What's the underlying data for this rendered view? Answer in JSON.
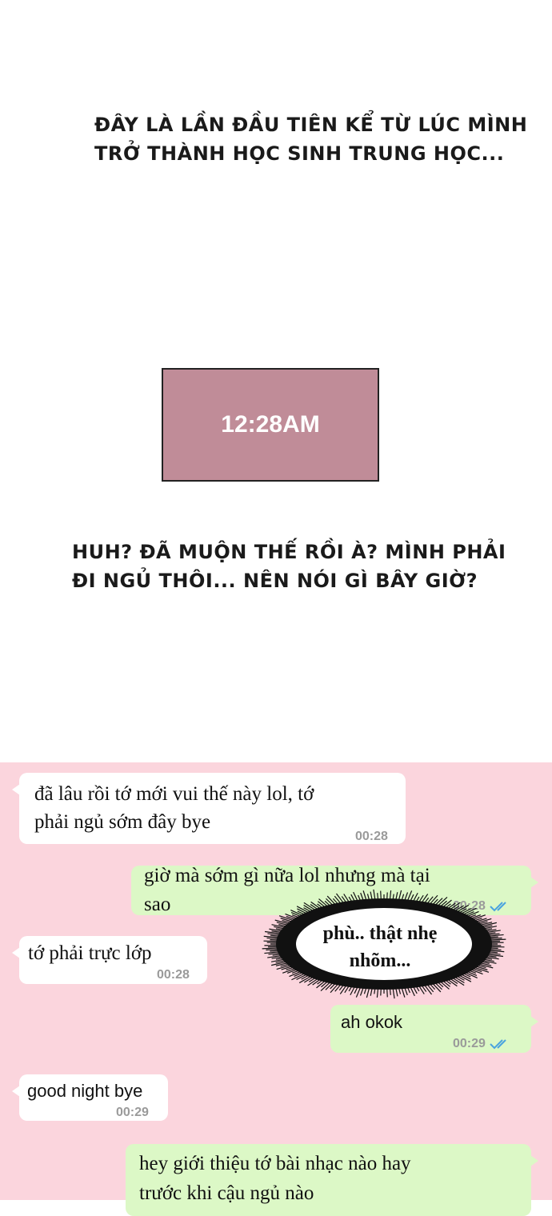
{
  "narration_1": {
    "line1": "ĐÂY LÀ LẦN ĐẦU TIÊN KỂ TỪ LÚC MÌNH",
    "line2": "TRỞ THÀNH HỌC SINH TRUNG HỌC..."
  },
  "clock": {
    "time": "12:28AM",
    "color": "#c08c98"
  },
  "narration_2": {
    "line1": "HUH? ĐÃ MUỘN THẾ RỒI À? MÌNH PHẢI",
    "line2": "ĐI NGỦ THÔI... NÊN NÓI GÌ BÂY GIỜ?"
  },
  "chat": {
    "background": "#fbd5dd",
    "messages": [
      {
        "direction": "incoming",
        "line1": "đã lâu rồi tớ mới vui thế này lol, tớ",
        "line2": "phải ngủ sớm đây bye",
        "time": "00:28"
      },
      {
        "direction": "outgoing",
        "line1": "giờ mà sớm gì nữa lol nhưng mà tại",
        "line2": "sao",
        "time": "00:28",
        "status_icon": "double-check-icon"
      },
      {
        "direction": "incoming",
        "line1": "tớ phải trực lớp",
        "time": "00:28"
      },
      {
        "direction": "outgoing",
        "line1": "ah okok",
        "time": "00:29",
        "status_icon": "double-check-icon"
      },
      {
        "direction": "incoming",
        "line1": "good night bye",
        "time": "00:29"
      },
      {
        "direction": "outgoing",
        "line1": "hey giới thiệu tớ bài nhạc nào hay",
        "line2": "trước khi cậu ngủ nào"
      }
    ],
    "thought": {
      "line1": "phù.. thật nhẹ",
      "line2": "nhõm..."
    }
  }
}
